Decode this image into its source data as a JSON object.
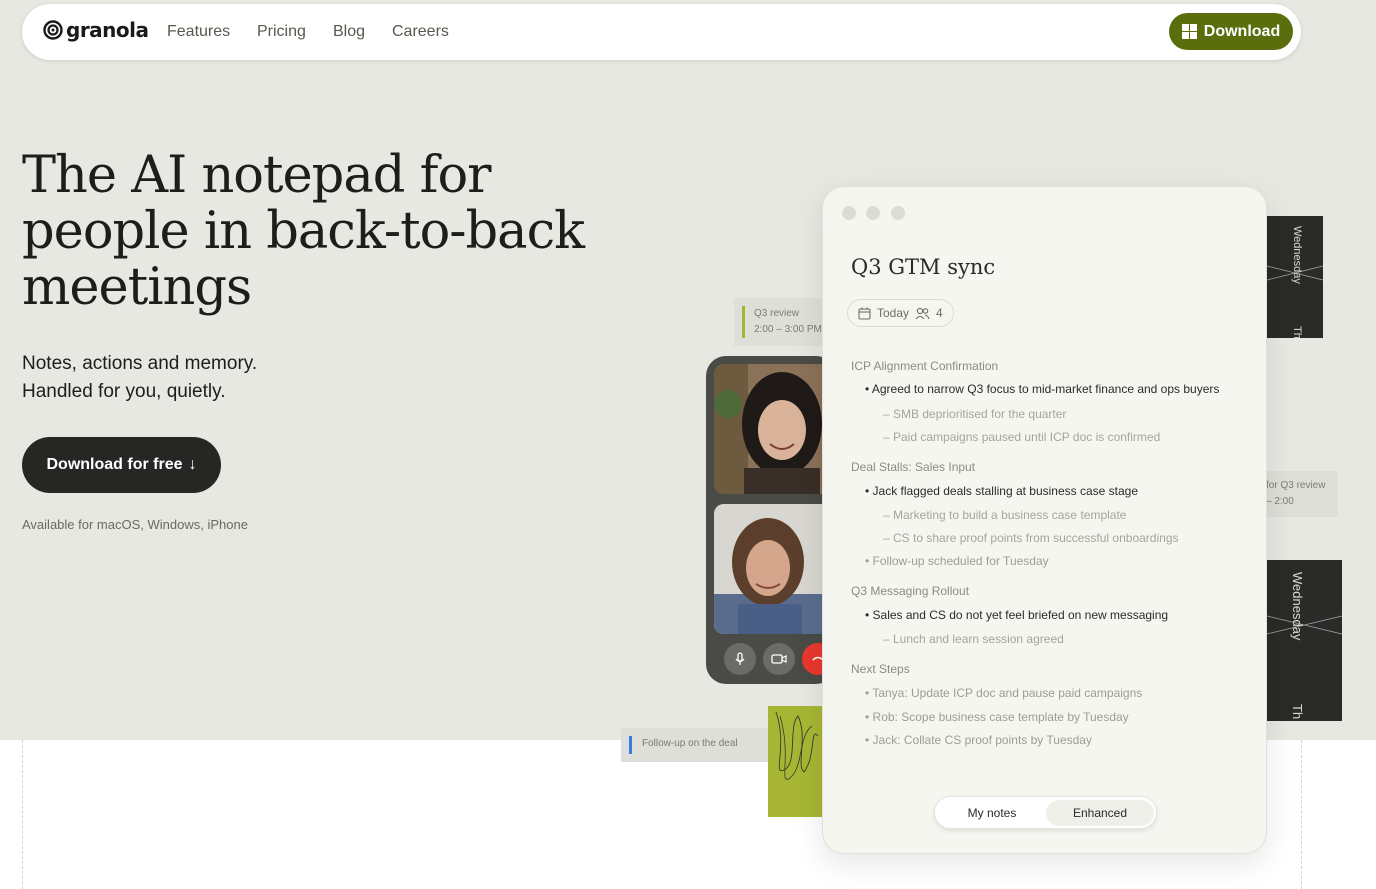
{
  "nav": {
    "logo": "granola",
    "links": [
      "Features",
      "Pricing",
      "Blog",
      "Careers"
    ],
    "download_label": "Download"
  },
  "hero": {
    "headline": "The AI notepad for people in back-to-back meetings",
    "sub_line1": "Notes, actions and memory.",
    "sub_line2": "Handled for you, quietly.",
    "cta_label": "Download for free",
    "cta_arrow": "↓",
    "availability": "Available for macOS, Windows, iPhone"
  },
  "calendar": {
    "event1_title": "Q3 review",
    "event1_time": "2:00 – 3:00 PM",
    "event2_title": "for Q3 review",
    "event2_time": "– 2:00",
    "event3_title": "Follow-up on the deal",
    "day_label_1": "Wednesday",
    "day_label_2": "Wednesday",
    "day_abbrev_1": "Th",
    "day_abbrev_2": "Th",
    "accent_green": "#a6b634",
    "accent_blue": "#3d7be0"
  },
  "notes": {
    "title": "Q3 GTM sync",
    "date_label": "Today",
    "attendee_count": "4",
    "sections": [
      {
        "heading": "ICP Alignment Confirmation",
        "items": [
          {
            "text": "• Agreed to narrow Q3 focus to mid-market finance and ops buyers"
          },
          {
            "text": "– SMB deprioritised for the quarter"
          },
          {
            "text": "– Paid campaigns paused until ICP doc is confirmed"
          }
        ]
      },
      {
        "heading": "Deal Stalls: Sales Input",
        "items": [
          {
            "text": "• Jack flagged deals stalling at business case stage"
          },
          {
            "text": "– Marketing to build a business case template"
          },
          {
            "text": "– CS to share proof points from successful onboardings"
          },
          {
            "text": "• Follow-up scheduled for Tuesday"
          }
        ]
      },
      {
        "heading": "Q3 Messaging Rollout",
        "items": [
          {
            "text": "• Sales and CS do not yet feel briefed on new messaging"
          },
          {
            "text": "– Lunch and learn session agreed"
          }
        ]
      },
      {
        "heading": "Next Steps",
        "items": [
          {
            "text": "• Tanya: Update ICP doc and pause paid campaigns"
          },
          {
            "text": "• Rob: Scope business case template by Tuesday"
          },
          {
            "text": "• Jack: Collate CS proof points by Tuesday"
          }
        ]
      }
    ],
    "toggle_my_notes": "My notes",
    "toggle_enhanced": "Enhanced"
  },
  "colors": {
    "brand_green": "#5b6e0e",
    "hero_bg": "#e8e8e2",
    "dark_button": "#262624",
    "end_call_red": "#e8382f"
  }
}
